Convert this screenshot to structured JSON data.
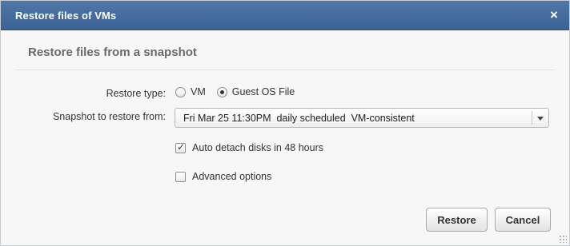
{
  "dialog": {
    "title": "Restore files of VMs",
    "close_glyph": "×",
    "subtitle": "Restore files from a snapshot"
  },
  "form": {
    "restore_type_label": "Restore type:",
    "restore_type_options": [
      {
        "label": "VM",
        "checked": false
      },
      {
        "label": "Guest OS File",
        "checked": true
      }
    ],
    "snapshot_label": "Snapshot to restore from:",
    "snapshot_value": "Fri Mar 25 11:30PM  daily scheduled  VM-consistent",
    "auto_detach": {
      "label": "Auto detach disks in 48 hours",
      "checked": true
    },
    "advanced": {
      "label": "Advanced options",
      "checked": false
    }
  },
  "buttons": {
    "restore": "Restore",
    "cancel": "Cancel"
  },
  "icons": {
    "close": "close-icon",
    "dropdown": "chevron-down-icon",
    "resize": "resize-grip-icon"
  },
  "colors": {
    "titlebar": "#3b6292",
    "title_text": "#ffffff",
    "subtitle_text": "#6a6a6a"
  }
}
